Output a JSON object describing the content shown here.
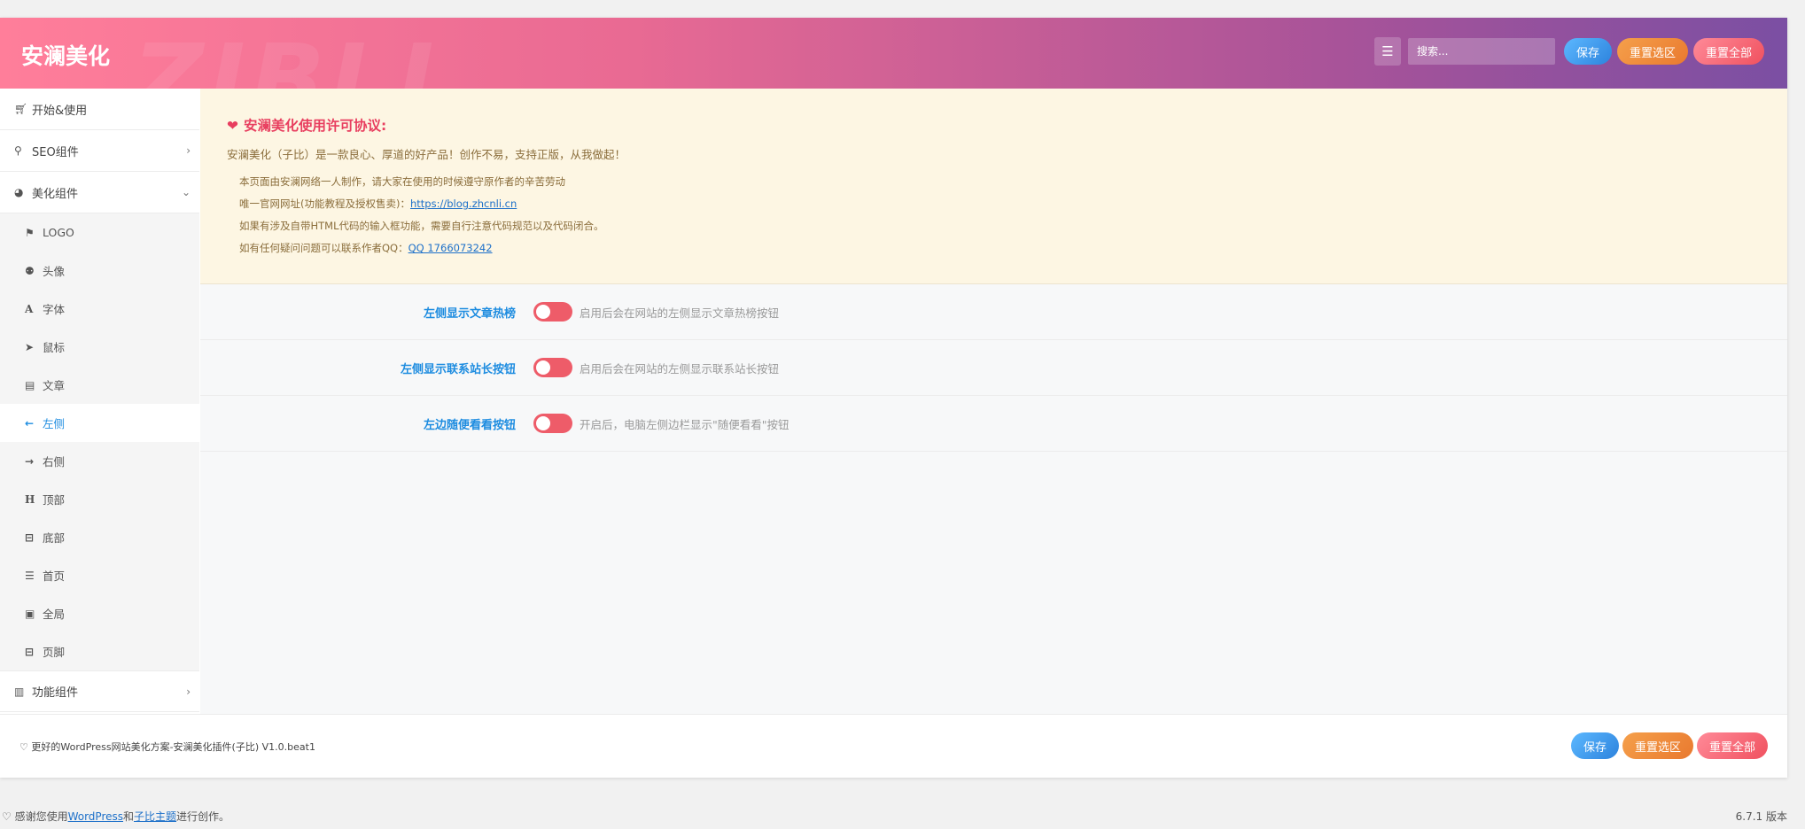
{
  "header": {
    "brand": "安澜美化",
    "watermark": "ZIBLL",
    "search_placeholder": "搜索...",
    "save_label": "保存",
    "reset_section_label": "重置选区",
    "reset_all_label": "重置全部"
  },
  "sidebar": {
    "top_items": [
      {
        "icon": "cart-icon",
        "label": "开始&使用"
      },
      {
        "icon": "search-icon",
        "label": "SEO组件"
      },
      {
        "icon": "dashboard-icon",
        "label": "美化组件"
      }
    ],
    "sub_items": [
      {
        "icon": "flag-icon",
        "label": "LOGO"
      },
      {
        "icon": "user-icon",
        "label": "头像"
      },
      {
        "icon": "font-icon",
        "label": "字体"
      },
      {
        "icon": "cursor-icon",
        "label": "鼠标"
      },
      {
        "icon": "book-icon",
        "label": "文章"
      },
      {
        "icon": "arrow-left-icon",
        "label": "左侧"
      },
      {
        "icon": "arrow-right-icon",
        "label": "右侧"
      },
      {
        "icon": "heading-icon",
        "label": "顶部"
      },
      {
        "icon": "minus-square-icon",
        "label": "底部"
      },
      {
        "icon": "list-icon",
        "label": "首页"
      },
      {
        "icon": "image-icon",
        "label": "全局"
      },
      {
        "icon": "minus-square-icon",
        "label": "页脚"
      }
    ],
    "bottom_item": {
      "icon": "building-icon",
      "label": "功能组件"
    }
  },
  "notice": {
    "title": "安澜美化使用许可协议:",
    "intro": "安澜美化（子比）是一款良心、厚道的好产品！创作不易，支持正版，从我做起！",
    "line1": "本页面由安澜网络一人制作，请大家在使用的时候遵守原作者的辛苦劳动",
    "line2_prefix": "唯一官网网址(功能教程及授权售卖)：",
    "line2_link": "https://blog.zhcnli.cn",
    "line3": "如果有涉及自带HTML代码的输入框功能，需要自行注意代码规范以及代码闭合。",
    "line4_prefix": "如有任何疑问问题可以联系作者QQ：",
    "line4_link": "QQ 1766073242"
  },
  "options": [
    {
      "label": "左侧显示文章热榜",
      "desc": "启用后会在网站的左侧显示文章热榜按钮",
      "enabled": false
    },
    {
      "label": "左侧显示联系站长按钮",
      "desc": "启用后会在网站的左侧显示联系站长按钮",
      "enabled": false
    },
    {
      "label": "左边随便看看按钮",
      "desc": "开启后，电脑左侧边栏显示\"随便看看\"按钮",
      "enabled": false
    }
  ],
  "footer": {
    "note": "♡ 更好的WordPress网站美化方案-安澜美化插件(子比) V1.0.beat1",
    "save_label": "保存",
    "reset_section_label": "重置选区",
    "reset_all_label": "重置全部"
  },
  "wp_footer": {
    "prefix": "♡ 感谢您使用",
    "link1": "WordPress",
    "middle": "和",
    "link2": "子比主题",
    "suffix": "进行创作。",
    "version": "6.7.1 版本"
  },
  "colors": {
    "accent": "#1d8ce0",
    "toggle_off": "#ee5c69",
    "notice_bg": "#fdf6e3"
  }
}
